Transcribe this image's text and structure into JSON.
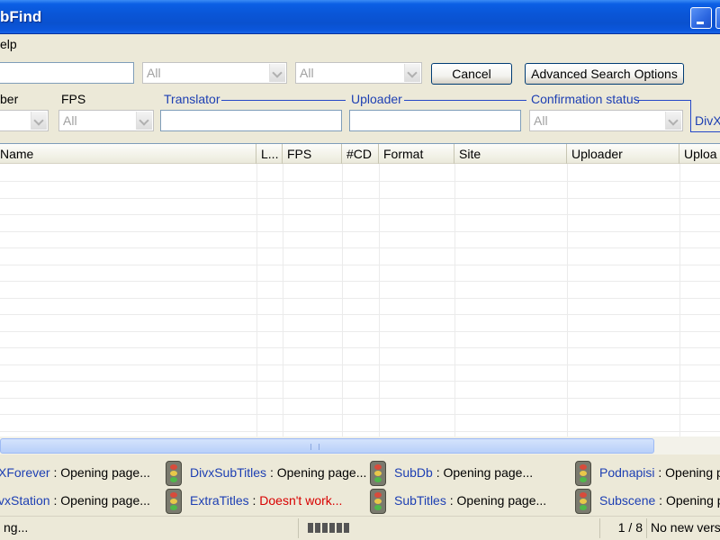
{
  "window": {
    "title": "bFind"
  },
  "menu": {
    "items": [
      "elp"
    ]
  },
  "search": {
    "query_value": "",
    "combo1_value": "All",
    "combo2_value": "All",
    "cancel_label": "Cancel",
    "advanced_label": "Advanced Search Options"
  },
  "filters": {
    "number_label": "ber",
    "fps_label": "FPS",
    "fps_value": "All",
    "number_value": "",
    "translator_label": "Translator",
    "uploader_label": "Uploader",
    "confirmation_label": "Confirmation status",
    "confirmation_value": "All",
    "divx_label": "DivX"
  },
  "table": {
    "columns": [
      "Name",
      "L...",
      "FPS",
      "#CD",
      "Format",
      "Site",
      "Uploader",
      "Uploa"
    ],
    "rows": []
  },
  "sites": [
    {
      "name": "XForever",
      "status": "Opening page...",
      "error": false
    },
    {
      "name": "DivxSubTitles",
      "status": "Opening page...",
      "error": false
    },
    {
      "name": "SubDb",
      "status": "Opening page...",
      "error": false
    },
    {
      "name": "Podnapisi",
      "status": "Opening pa",
      "error": false
    },
    {
      "name": "vxStation",
      "status": "Opening page...",
      "error": false
    },
    {
      "name": "ExtraTitles",
      "status": "Doesn't work...",
      "error": true
    },
    {
      "name": "SubTitles",
      "status": "Opening page...",
      "error": false
    },
    {
      "name": "Subscene",
      "status": "Opening pa",
      "error": false
    }
  ],
  "statusbar": {
    "left_text": "ng...",
    "page_counter": "1 / 8",
    "version_text": "No new vers"
  },
  "colors": {
    "titlebar": "#0a56d8",
    "link_blue": "#1d3fb3",
    "error_red": "#d80000"
  }
}
